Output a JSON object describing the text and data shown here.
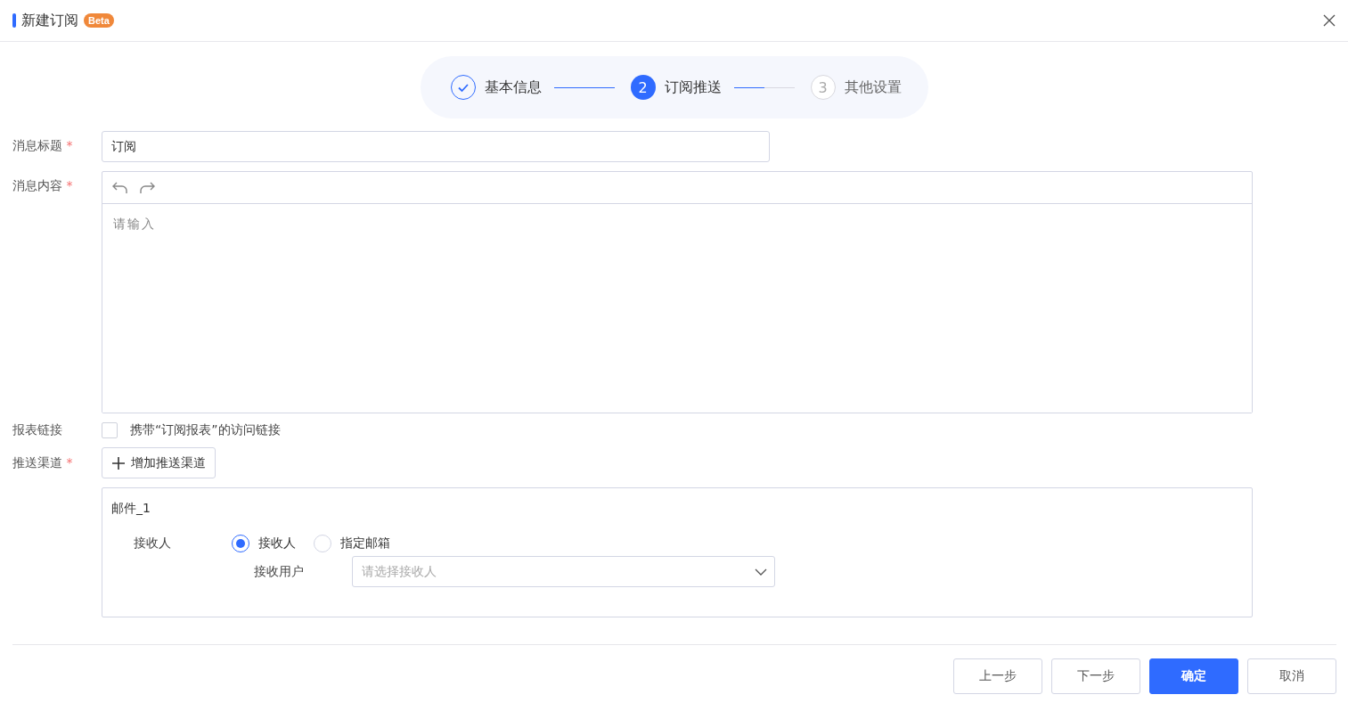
{
  "dialog": {
    "title": "新建订阅",
    "badge": "Beta"
  },
  "steps": [
    {
      "label": "基本信息",
      "kind": "completed"
    },
    {
      "number": "2",
      "label": "订阅推送",
      "kind": "active"
    },
    {
      "number": "3",
      "label": "其他设置",
      "kind": "upcoming"
    }
  ],
  "form": {
    "title_field": {
      "label": "消息标题",
      "required_mark": "*",
      "value": "订阅"
    },
    "content_field": {
      "label": "消息内容",
      "required_mark": "*",
      "placeholder": "请输入"
    },
    "report_link": {
      "label": "报表链接",
      "checked": false,
      "text": "携带“订阅报表”的访问链接"
    },
    "channels": {
      "label": "推送渠道",
      "required_mark": "*",
      "add_button": "增加推送渠道",
      "items": [
        {
          "name": "邮件_1",
          "recipient_label": "接收人",
          "options": [
            {
              "label": "接收人",
              "selected": true
            },
            {
              "label": "指定邮箱",
              "selected": false
            }
          ],
          "user_label": "接收用户",
          "user_placeholder": "请选择接收人"
        }
      ]
    }
  },
  "buttons": [
    {
      "label": "上一步",
      "kind": "default"
    },
    {
      "label": "下一步",
      "kind": "default"
    },
    {
      "label": "确定",
      "kind": "primary"
    },
    {
      "label": "取消",
      "kind": "default"
    }
  ]
}
